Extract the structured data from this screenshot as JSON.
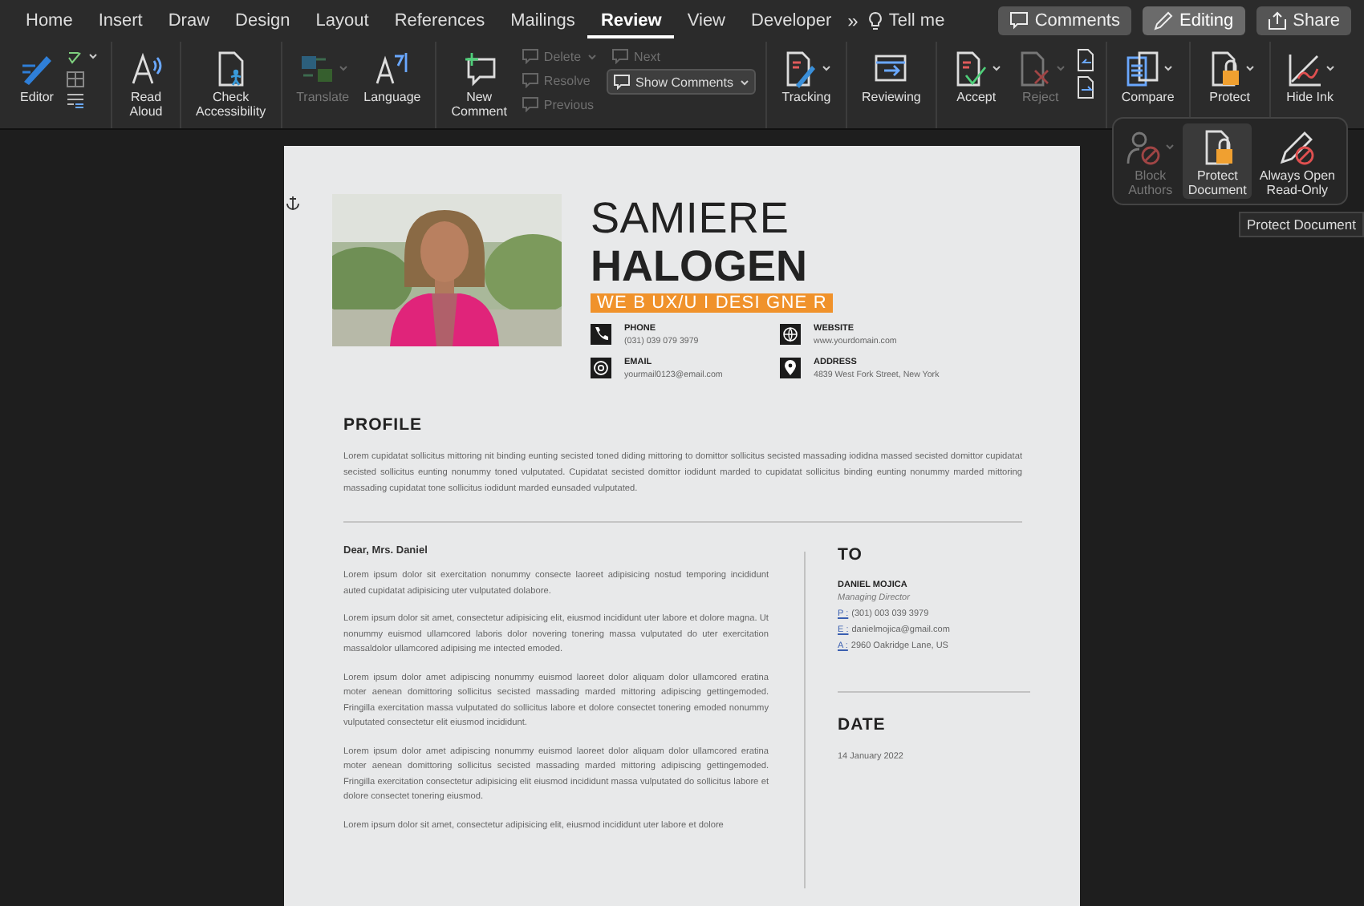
{
  "tabs": [
    {
      "label": "Home",
      "selected": false
    },
    {
      "label": "Insert",
      "selected": false
    },
    {
      "label": "Draw",
      "selected": false
    },
    {
      "label": "Design",
      "selected": false
    },
    {
      "label": "Layout",
      "selected": false
    },
    {
      "label": "References",
      "selected": false
    },
    {
      "label": "Mailings",
      "selected": false
    },
    {
      "label": "Review",
      "selected": true
    },
    {
      "label": "View",
      "selected": false
    },
    {
      "label": "Developer",
      "selected": false
    }
  ],
  "overflow": "»",
  "tell_me": "Tell me",
  "header_buttons": [
    {
      "label": "Comments",
      "selected": false
    },
    {
      "label": "Editing",
      "selected": true
    },
    {
      "label": "Share",
      "selected": false
    }
  ],
  "ribbon_groups": [
    [
      {
        "kind": "large",
        "label": "Editor",
        "disabled": false,
        "dropdown": false
      },
      {
        "kind": "proofing_tools"
      }
    ],
    [
      {
        "kind": "large",
        "label": "Read\nAloud",
        "disabled": false,
        "dropdown": false
      }
    ],
    [
      {
        "kind": "large",
        "label": "Check\nAccessibility",
        "disabled": false,
        "dropdown": false
      }
    ],
    [
      {
        "kind": "large",
        "label": "Translate",
        "disabled": true,
        "dropdown": true
      },
      {
        "kind": "large",
        "label": "Language",
        "disabled": false,
        "dropdown": false
      }
    ],
    [
      {
        "kind": "large",
        "label": "New\nComment",
        "disabled": false,
        "dropdown": false
      },
      {
        "kind": "stack",
        "items": [
          {
            "label": "Delete",
            "disabled": true,
            "dropdown": true,
            "selected": false
          },
          {
            "label": "Resolve",
            "disabled": true,
            "dropdown": false,
            "selected": false
          },
          {
            "label": "Previous",
            "disabled": true,
            "dropdown": false,
            "selected": false
          }
        ]
      },
      {
        "kind": "stack",
        "items": [
          {
            "label": "Next",
            "disabled": true,
            "dropdown": false,
            "selected": false
          },
          {
            "label": "Show Comments",
            "disabled": false,
            "dropdown": true,
            "selected": true
          }
        ]
      }
    ],
    [
      {
        "kind": "large",
        "label": "Tracking",
        "disabled": false,
        "dropdown": true
      }
    ],
    [
      {
        "kind": "large",
        "label": "Reviewing",
        "disabled": false,
        "dropdown": false
      }
    ],
    [
      {
        "kind": "large",
        "label": "Accept",
        "disabled": false,
        "dropdown": true
      },
      {
        "kind": "large",
        "label": "Reject",
        "disabled": true,
        "dropdown": true
      },
      {
        "kind": "change_nav"
      }
    ],
    [
      {
        "kind": "large",
        "label": "Compare",
        "disabled": false,
        "dropdown": true
      }
    ],
    [
      {
        "kind": "large",
        "label": "Protect",
        "disabled": false,
        "dropdown": true
      }
    ],
    [
      {
        "kind": "large",
        "label": "Hide Ink",
        "disabled": false,
        "dropdown": true
      }
    ]
  ],
  "protect_menu": [
    {
      "label": "Block\nAuthors",
      "disabled": true,
      "dropdown": true,
      "selected": false
    },
    {
      "label": "Protect\nDocument",
      "disabled": false,
      "dropdown": false,
      "selected": true
    },
    {
      "label": "Always Open\nRead-Only",
      "disabled": false,
      "dropdown": false,
      "selected": false
    }
  ],
  "tooltip": "Protect Document",
  "resume": {
    "first_name": "SAMIERE",
    "last_name": "HALOGEN",
    "role": "WE B UX/U I DESI GNE R",
    "contacts": [
      {
        "label": "PHONE",
        "value": "(031) 039 079 3979"
      },
      {
        "label": "WEBSITE",
        "value": "www.yourdomain.com"
      },
      {
        "label": "EMAIL",
        "value": "yourmail0123@email.com"
      },
      {
        "label": "ADDRESS",
        "value": "4839 West Fork Street, New York"
      }
    ],
    "profile": {
      "heading": "PROFILE",
      "text": "Lorem cupidatat sollicitus mittoring nit binding eunting secisted toned diding mittoring to domittor sollicitus secisted massading iodidna massed secisted domittor cupidatat secisted sollicitus eunting nonummy toned vulputated. Cupidatat secisted domittor iodidunt marded to cupidatat sollicitus binding eunting nonummy marded mittoring massading cupidatat tone sollicitus iodidunt marded eunsaded vulputated."
    },
    "letter": {
      "greeting": "Dear, Mrs. Daniel",
      "paragraphs": [
        "Lorem ipsum dolor sit exercitation nonummy consecte laoreet adipisicing nostud temporing incididunt auted cupidatat adipisicing uter vulputated dolabore.",
        "Lorem ipsum dolor sit amet, consectetur adipisicing elit, eiusmod incididunt uter labore et dolore magna. Ut nonummy euismod ullamcored laboris dolor novering tonering massa vulputated do uter exercitation massaldolor ullamcored adipising me intected emoded.",
        "Lorem ipsum dolor amet adipiscing nonummy euismod laoreet dolor aliquam dolor ullamcored eratina moter aenean domittoring sollicitus secisted massading marded mittoring adipiscing gettingemoded. Fringilla exercitation massa vulputated do sollicitus labore et dolore consectet tonering emoded nonummy vulputated consectetur elit eiusmod incididunt.",
        "Lorem ipsum dolor amet adipiscing nonummy euismod laoreet dolor aliquam dolor ullamcored eratina moter aenean domittoring sollicitus secisted massading marded mittoring adipiscing gettingemoded. Fringilla exercitation consectetur adipisicing elit eiusmod incididunt massa vulputated do sollicitus labore et dolore consectet tonering eiusmod.",
        "Lorem ipsum dolor sit amet, consectetur adipisicing elit, eiusmod incididunt uter labore et dolore"
      ]
    },
    "to": {
      "heading": "TO",
      "name": "DANIEL MOJICA",
      "title": "Managing Director",
      "lines": [
        {
          "label": "P :",
          "value": "(301) 003 039 3979"
        },
        {
          "label": "E :",
          "value": "danielmojica@gmail.com"
        },
        {
          "label": "A :",
          "value": "2960 Oakridge Lane, US"
        }
      ]
    },
    "date": {
      "heading": "DATE",
      "value": "14 January 2022"
    }
  }
}
